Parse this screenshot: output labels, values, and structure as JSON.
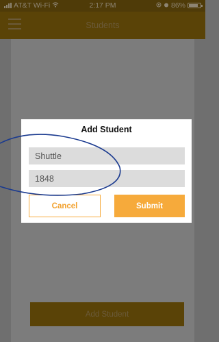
{
  "status_bar": {
    "carrier": "AT&T Wi-Fi",
    "time": "2:17 PM",
    "battery": "86%",
    "battery_level": 0.86
  },
  "nav": {
    "title": "Students"
  },
  "footer": {
    "add_student_label": "Add Student"
  },
  "dialog": {
    "title": "Add Student",
    "name_value": "Shuttle",
    "id_value": "1848",
    "cancel_label": "Cancel",
    "submit_label": "Submit"
  },
  "colors": {
    "accent": "#f6aa3b",
    "nav_bg": "#5a4307",
    "annotation": "#1a3a8f"
  }
}
